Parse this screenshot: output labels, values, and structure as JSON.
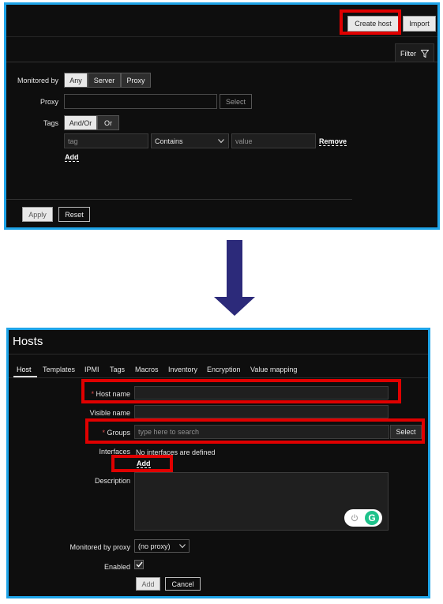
{
  "colors": {
    "panel_border": "#1ea4e8",
    "highlight": "#e00000",
    "arrow": "#2c2a7a",
    "toggle_green": "#1ec28b"
  },
  "top": {
    "create_host": "Create host",
    "import": "Import",
    "filter_tab": "Filter",
    "monitored_by_label": "Monitored by",
    "monitored_by_options": [
      "Any",
      "Server",
      "Proxy"
    ],
    "monitored_by_selected": "Any",
    "proxy_label": "Proxy",
    "proxy_select": "Select",
    "tags_label": "Tags",
    "tags_options": [
      "And/Or",
      "Or"
    ],
    "tags_selected": "And/Or",
    "tag_placeholder": "tag",
    "operator_value": "Contains",
    "value_placeholder": "value",
    "remove": "Remove",
    "add": "Add",
    "apply": "Apply",
    "reset": "Reset"
  },
  "bottom": {
    "title": "Hosts",
    "tabs": [
      "Host",
      "Templates",
      "IPMI",
      "Tags",
      "Macros",
      "Inventory",
      "Encryption",
      "Value mapping"
    ],
    "active_tab": "Host",
    "host_name_label": "Host name",
    "visible_name_label": "Visible name",
    "groups_label": "Groups",
    "groups_placeholder": "type here to search",
    "groups_select": "Select",
    "interfaces_label": "Interfaces",
    "interfaces_text": "No interfaces are defined",
    "interfaces_add": "Add",
    "description_label": "Description",
    "monitored_by_proxy_label": "Monitored by proxy",
    "proxy_value": "(no proxy)",
    "enabled_label": "Enabled",
    "enabled": true,
    "add_button": "Add",
    "cancel_button": "Cancel"
  }
}
